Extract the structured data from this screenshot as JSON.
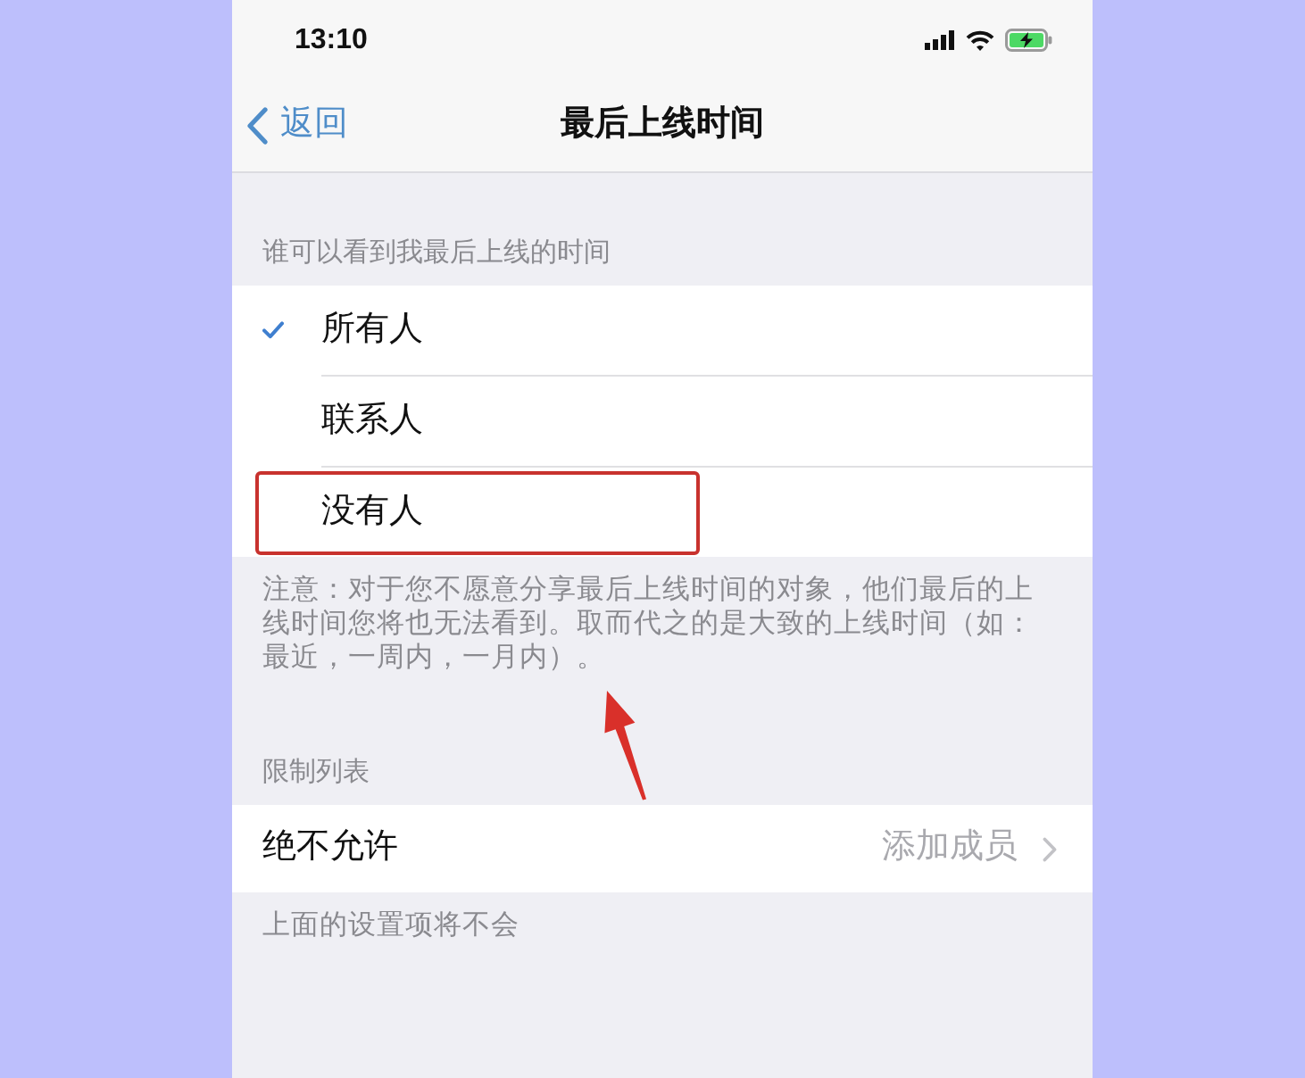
{
  "status_bar": {
    "time": "13:10"
  },
  "nav_bar": {
    "back": "返回",
    "title": "最后上线时间"
  },
  "sections": [
    {
      "kind": "choices",
      "header": "谁可以看到我最后上线的时间",
      "options": [
        {
          "label": "所有人",
          "selected": true,
          "highlighted": false
        },
        {
          "label": "联系人",
          "selected": false,
          "highlighted": false
        },
        {
          "label": "没有人",
          "selected": false,
          "highlighted": true
        }
      ],
      "footer": "注意：对于您不愿意分享最后上线时间的对象，他们最后的上线时间您将也无法看到。取而代之的是大致的上线时间（如：最近，一周内，一月内）。"
    },
    {
      "kind": "links",
      "header": "限制列表",
      "rows": [
        {
          "label": "绝不允许",
          "value": "添加成员"
        }
      ],
      "footer": "上面的设置项将不会"
    }
  ]
}
